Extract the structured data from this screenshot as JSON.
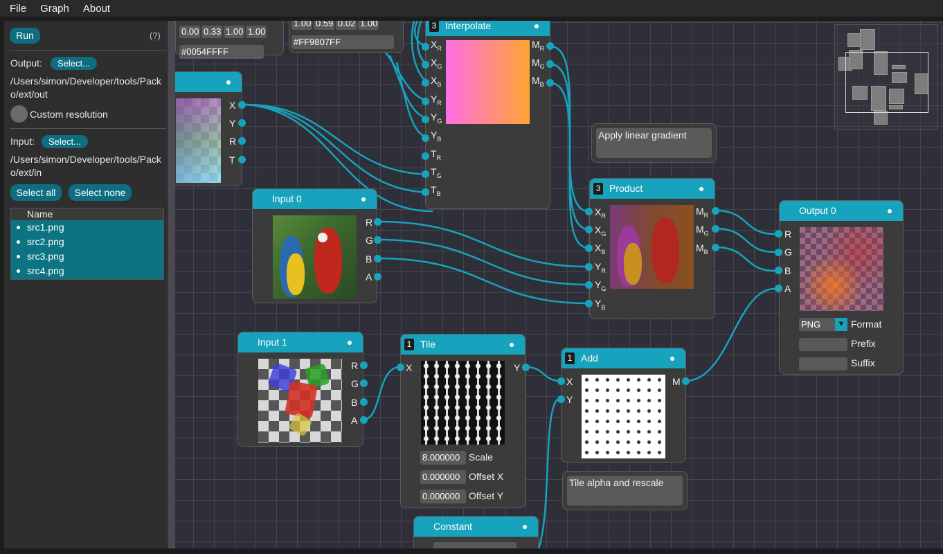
{
  "menu": [
    "File",
    "Graph",
    "About"
  ],
  "sidebar": {
    "run_label": "Run",
    "help_label": "(?)",
    "output_label": "Output:",
    "output_select": "Select...",
    "output_path": "/Users/simon/Developer/tools/Packo/ext/out",
    "custom_resolution": "Custom resolution",
    "input_label": "Input:",
    "input_select": "Select...",
    "input_path": "/Users/simon/Developer/tools/Packo/ext/in",
    "select_all": "Select all",
    "select_none": "Select none",
    "list_header": "Name",
    "files": [
      "src1.png",
      "src2.png",
      "src3.png",
      "src4.png"
    ]
  },
  "nodes": {
    "color_a": {
      "values": [
        "0.00",
        "0.33",
        "1.00",
        "1.00"
      ],
      "hex": "#0054FFFF"
    },
    "color_b": {
      "values": [
        "1.00",
        "0.59",
        "0.02",
        "1.00"
      ],
      "hex": "#FF9807FF"
    },
    "interpolate": {
      "badge": "3",
      "title": "Interpolate"
    },
    "gradient": {
      "ports": [
        "X",
        "Y",
        "R",
        "T"
      ]
    },
    "input0": {
      "title": "Input 0",
      "ports": [
        "R",
        "G",
        "B",
        "A"
      ]
    },
    "product": {
      "badge": "3",
      "title": "Product"
    },
    "output0": {
      "title": "Output 0",
      "inputs": [
        "R",
        "G",
        "B",
        "A"
      ],
      "format_value": "PNG",
      "format_label": "Format",
      "prefix_label": "Prefix",
      "suffix_label": "Suffix"
    },
    "input1": {
      "title": "Input 1",
      "ports": [
        "R",
        "G",
        "B",
        "A"
      ]
    },
    "tile": {
      "badge": "1",
      "title": "Tile",
      "in": "X",
      "out": "Y",
      "scale_value": "8.000000",
      "scale_label": "Scale",
      "offx_value": "0.000000",
      "offx_label": "Offset X",
      "offy_value": "0.000000",
      "offy_label": "Offset Y"
    },
    "add": {
      "badge": "1",
      "title": "Add",
      "in_x": "X",
      "in_y": "Y",
      "out": "M"
    },
    "constant": {
      "title": "Constant"
    }
  },
  "comments": {
    "gradient_note": "Apply linear gradient",
    "tile_note": "Tile alpha and rescale"
  },
  "colors": {
    "accent": "#17a3bd",
    "node_bg": "#3b3b3b",
    "canvas_bg": "#2e2f38"
  }
}
